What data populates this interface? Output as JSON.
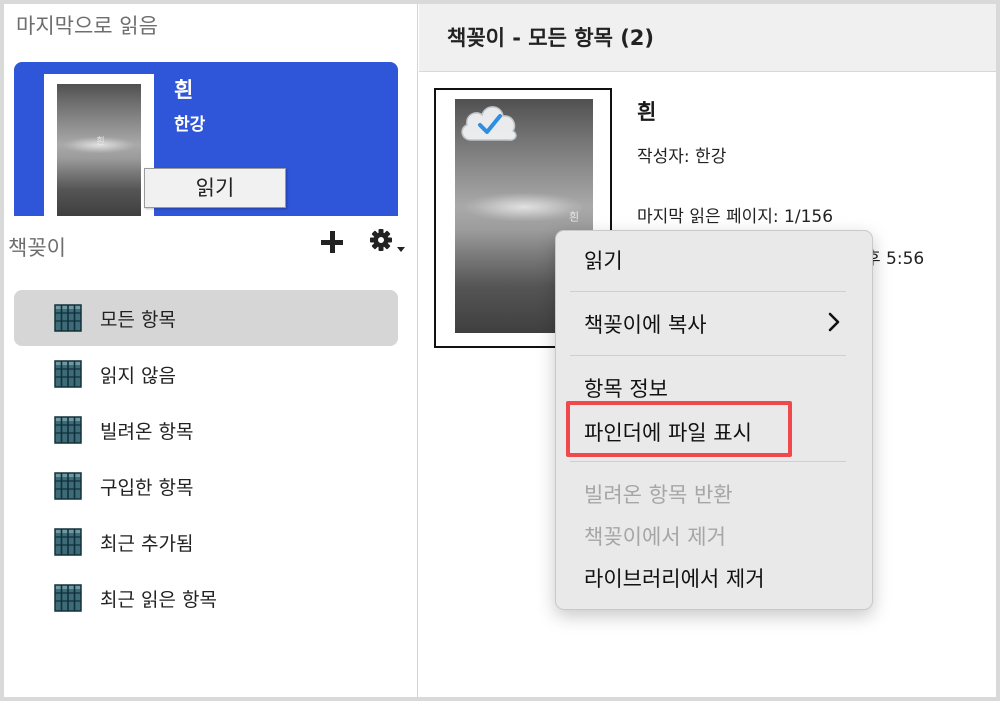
{
  "sidebar": {
    "recent_title": "마지막으로 읽음",
    "recent_book": {
      "title": "흰",
      "author": "한강",
      "read_button": "읽기",
      "cover_text": "흰"
    },
    "bookshelf_title": "책꽂이",
    "add_icon": "plus-icon",
    "settings_icon": "gear-icon",
    "items": [
      {
        "label": "모든 항목",
        "selected": true,
        "icon": "books-icon"
      },
      {
        "label": "읽지 않음",
        "icon": "books-icon"
      },
      {
        "label": "빌려온 항목",
        "icon": "books-icon"
      },
      {
        "label": "구입한 항목",
        "icon": "books-icon"
      },
      {
        "label": "최근 추가됨",
        "icon": "books-icon"
      },
      {
        "label": "최근 읽은 항목",
        "icon": "books-icon"
      }
    ]
  },
  "content": {
    "header_title": "책꽂이 - 모든 항목 (2)",
    "book": {
      "title": "흰",
      "author_line": "작성자: 한강",
      "last_page_line": "마지막 읽은 페이지: 1/156",
      "time_partial": "후 5:56",
      "cover_text": "흰",
      "cloud_icon": "cloud-check-icon"
    }
  },
  "context_menu": {
    "read": "읽기",
    "copy_to_shelf": "책꽂이에 복사",
    "item_info": "항목 정보",
    "show_in_finder": "파인더에 파일 표시",
    "return_borrowed": "빌려온 항목 반환",
    "remove_from_shelf": "책꽂이에서 제거",
    "remove_from_library": "라이브러리에서 제거",
    "highlight_color": "#f0484d"
  },
  "colors": {
    "accent": "#2f56d9",
    "selected_bg": "#d6d6d6",
    "icon_teal": "#3d6c78"
  }
}
